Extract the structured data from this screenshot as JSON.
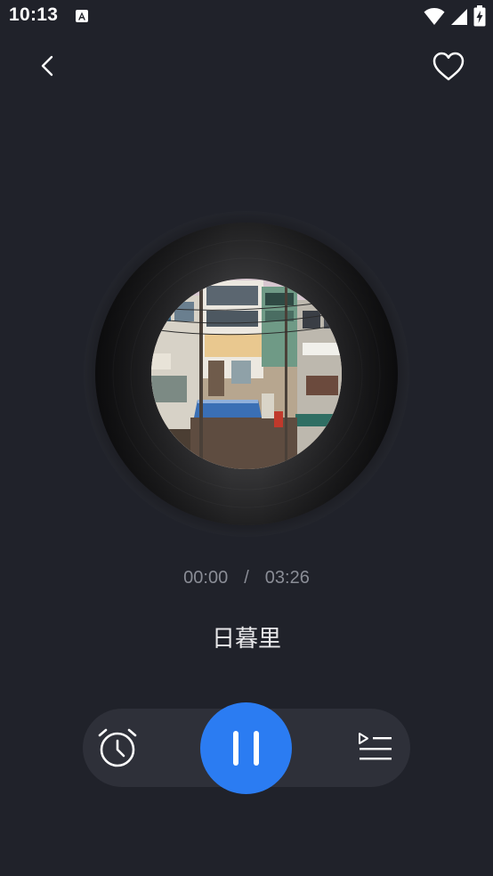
{
  "status_bar": {
    "time": "10:13",
    "app_icon": "a-notification-icon",
    "icons": [
      "wifi-icon",
      "signal-icon",
      "battery-charging-icon"
    ]
  },
  "header": {
    "back_icon": "chevron-left-icon",
    "favorite_icon": "heart-outline-icon"
  },
  "player": {
    "current_time": "00:00",
    "separator": "/",
    "total_time": "03:26",
    "progress": 0,
    "song_title": "日暮里",
    "is_playing": true
  },
  "controls": {
    "timer_icon": "alarm-clock-icon",
    "play_pause_icon": "pause-icon",
    "playlist_icon": "playlist-icon"
  },
  "colors": {
    "background": "#20222a",
    "control_bar": "#2e3039",
    "accent": "#2b7cf2",
    "time_text": "#8a8d96"
  }
}
